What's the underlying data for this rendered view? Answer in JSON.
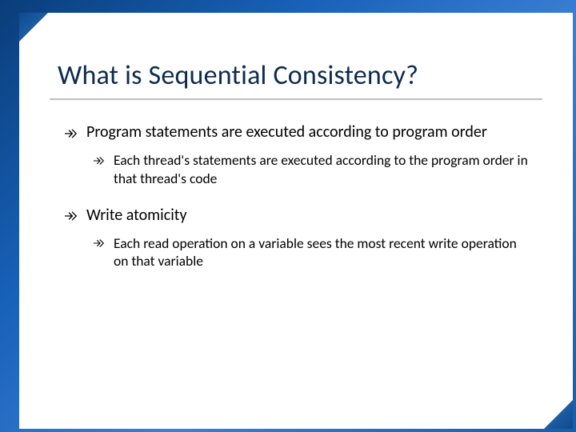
{
  "slide": {
    "title": "What is Sequential Consistency?",
    "bullets": [
      {
        "level": 1,
        "text": "Program statements are executed according to program order"
      },
      {
        "level": 2,
        "text": "Each thread's statements are executed according  to the program order in that thread's code"
      },
      {
        "level": 1,
        "text": "Write atomicity"
      },
      {
        "level": 2,
        "text": "Each read operation on a variable sees the most recent write operation on that variable"
      }
    ]
  }
}
